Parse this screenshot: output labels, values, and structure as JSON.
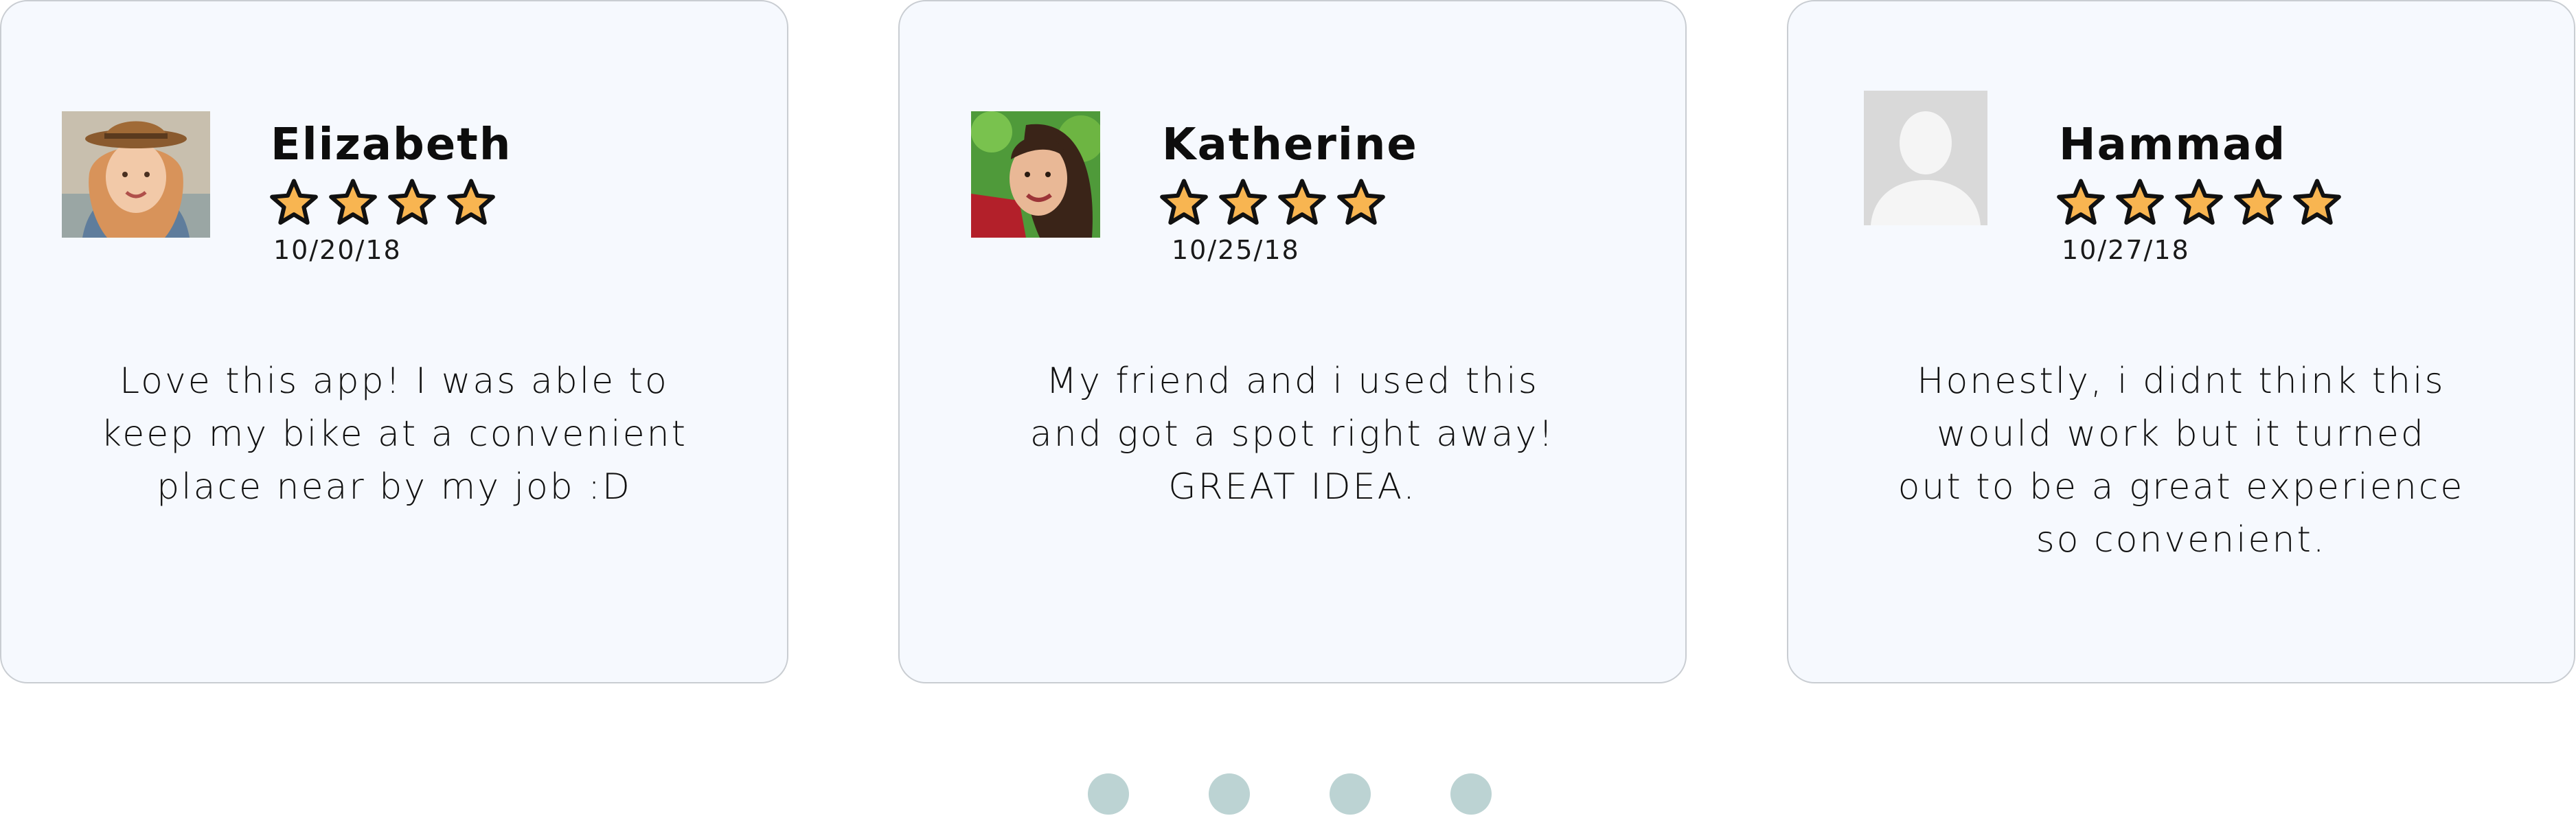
{
  "reviews": [
    {
      "name": "Elizabeth",
      "rating": 4,
      "date": "10/20/18",
      "text": [
        "Love this app! I was able to",
        "keep my bike at a convenient",
        "place near by my job :D"
      ],
      "avatar_icon": "user-photo"
    },
    {
      "name": "Katherine",
      "rating": 4,
      "date": "10/25/18",
      "text": [
        "My friend and i used this",
        "and got a spot right away!",
        "GREAT IDEA."
      ],
      "avatar_icon": "user-photo"
    },
    {
      "name": "Hammad",
      "rating": 5,
      "date": "10/27/18",
      "text": [
        "Honestly, i didnt think this",
        "would work but it turned",
        "out to be a great experience",
        "so convenient."
      ],
      "avatar_icon": "default-user-placeholder"
    }
  ],
  "carousel": {
    "dot_count": 4
  },
  "colors": {
    "card_bg": "#f6f9fe",
    "card_border": "#c9cdd2",
    "star_fill": "#f8b551",
    "star_stroke": "#111111",
    "dot": "#bcd3d3"
  }
}
